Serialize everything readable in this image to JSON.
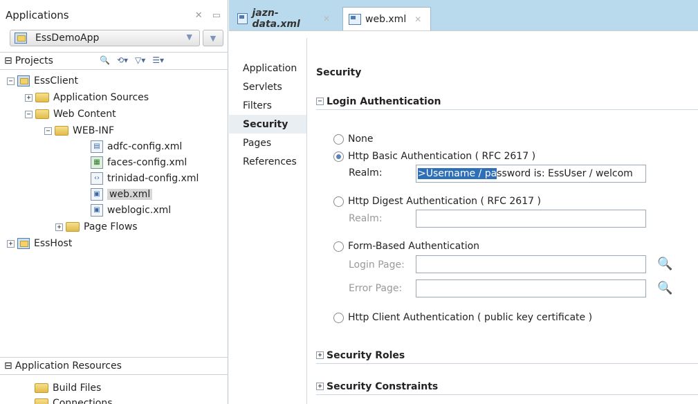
{
  "left_panel": {
    "title": "Applications",
    "app_name": "EssDemoApp",
    "projects_label": "Projects",
    "tree": [
      {
        "label": "EssClient"
      },
      {
        "label": "Application Sources"
      },
      {
        "label": "Web Content"
      },
      {
        "label": "WEB-INF"
      },
      {
        "label": "adfc-config.xml"
      },
      {
        "label": "faces-config.xml"
      },
      {
        "label": "trinidad-config.xml"
      },
      {
        "label": "web.xml"
      },
      {
        "label": "weblogic.xml"
      },
      {
        "label": "Page Flows"
      },
      {
        "label": "EssHost"
      }
    ],
    "resources_label": "Application Resources",
    "resources": [
      {
        "label": "Build Files"
      },
      {
        "label": "Connections"
      }
    ]
  },
  "tabs": [
    {
      "label": "jazn-data.xml"
    },
    {
      "label": "web.xml"
    }
  ],
  "nav": [
    "Application",
    "Servlets",
    "Filters",
    "Security",
    "Pages",
    "References"
  ],
  "content": {
    "title": "Security",
    "login_section": "Login Authentication",
    "options": {
      "none": "None",
      "basic": "Http Basic Authentication ( RFC 2617 )",
      "digest": "Http Digest Authentication ( RFC 2617 )",
      "form": "Form-Based Authentication",
      "client": "Http Client Authentication ( public key certificate )"
    },
    "realm_label": "Realm:",
    "realm_value_selected": ">Username / pa",
    "realm_value_rest": "ssword is: EssUser / welcom",
    "login_page_label": "Login Page:",
    "error_page_label": "Error Page:",
    "roles_section": "Security Roles",
    "constraints_section": "Security Constraints"
  },
  "colors": {
    "tab_bar": "#b9d9ec",
    "selection": "#2f6fb8"
  }
}
